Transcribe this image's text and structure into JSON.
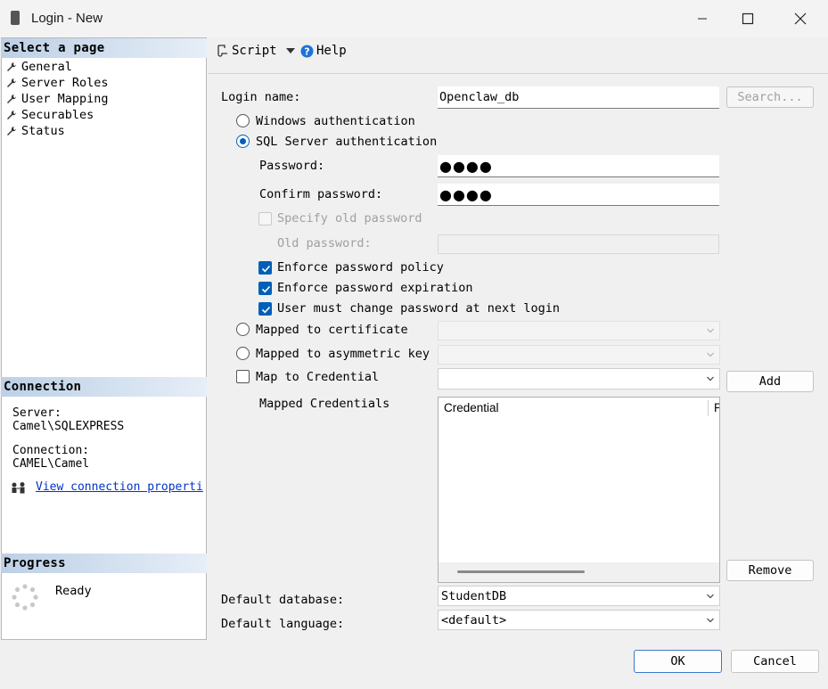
{
  "window": {
    "title": "Login - New"
  },
  "left": {
    "select_page": "Select a page",
    "pages": [
      "General",
      "Server Roles",
      "User Mapping",
      "Securables",
      "Status"
    ],
    "connection_title": "Connection",
    "server_label": "Server:",
    "server_value": "Camel\\SQLEXPRESS",
    "connection_label": "Connection:",
    "connection_value": "CAMEL\\Camel",
    "view_link": "View connection properti",
    "progress_title": "Progress",
    "progress_status": "Ready"
  },
  "toolbar": {
    "script": "Script",
    "help": "Help"
  },
  "form": {
    "login_name_label": "Login name:",
    "login_name_value": "Openclaw_db",
    "search_button": "Search...",
    "windows_auth": "Windows authentication",
    "sql_auth": "SQL Server authentication",
    "password_label": "Password:",
    "password_value": "●●●●",
    "confirm_label": "Confirm password:",
    "confirm_value": "●●●●",
    "specify_old": "Specify old password",
    "old_password_label": "Old password:",
    "enforce_policy": "Enforce password policy",
    "enforce_expiration": "Enforce password expiration",
    "must_change": "User must change password at next login",
    "mapped_cert": "Mapped to certificate",
    "mapped_asym": "Mapped to asymmetric key",
    "map_credential": "Map to Credential",
    "add_button": "Add",
    "mapped_credentials": "Mapped Credentials",
    "grid_col1": "Credential",
    "grid_col2": "P",
    "remove_button": "Remove",
    "default_db_label": "Default database:",
    "default_db_value": "StudentDB",
    "default_lang_label": "Default language:",
    "default_lang_value": "<default>"
  },
  "buttons": {
    "ok": "OK",
    "cancel": "Cancel"
  },
  "colors": {
    "accent": "#005fb8",
    "header_gradient": "#bcd0e6",
    "link": "#0033cc"
  }
}
